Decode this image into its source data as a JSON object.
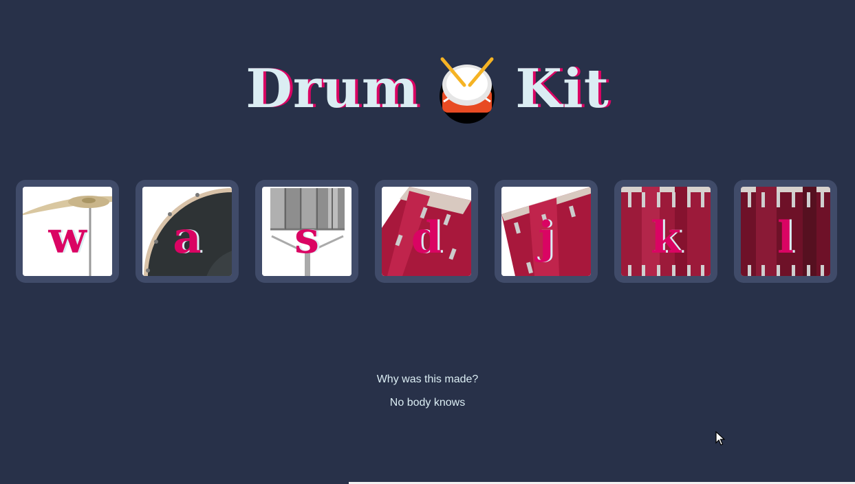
{
  "header": {
    "title_left": "Drum",
    "title_right": "Kit",
    "icon": "drum-icon"
  },
  "drums": [
    {
      "key": "w",
      "instrument": "crash-cymbal"
    },
    {
      "key": "a",
      "instrument": "kick-drum"
    },
    {
      "key": "s",
      "instrument": "snare-drum"
    },
    {
      "key": "d",
      "instrument": "tom-1"
    },
    {
      "key": "j",
      "instrument": "tom-2"
    },
    {
      "key": "k",
      "instrument": "tom-3"
    },
    {
      "key": "l",
      "instrument": "tom-4"
    }
  ],
  "footer": {
    "line1": "Why was this made?",
    "line2": "No body knows"
  },
  "colors": {
    "background": "#283149",
    "tile": "#404B69",
    "accent": "#DA0463",
    "text": "#DBEDF3"
  }
}
